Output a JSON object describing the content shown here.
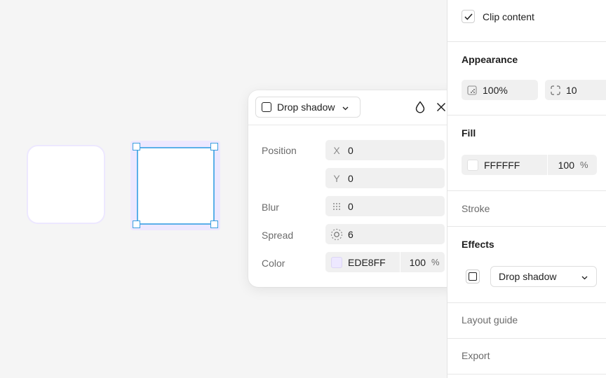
{
  "canvas": {
    "shadow_color": "#EDE8FF",
    "selection_color": "#3B9FE0"
  },
  "popover": {
    "effect_type": "Drop shadow",
    "icons": {
      "effect_swatch": "drop-shadow-icon",
      "chevron": "chevron-down-icon",
      "blend": "droplet-icon",
      "close": "close-icon"
    },
    "position_label": "Position",
    "x_prefix": "X",
    "x_value": "0",
    "y_prefix": "Y",
    "y_value": "0",
    "blur_label": "Blur",
    "blur_value": "0",
    "spread_label": "Spread",
    "spread_value": "6",
    "color_label": "Color",
    "color_hex": "EDE8FF",
    "color_opacity": "100",
    "percent": "%"
  },
  "panel": {
    "clip_content_label": "Clip content",
    "clip_content_checked": true,
    "appearance": {
      "title": "Appearance",
      "opacity": "100%",
      "corner_radius": "10"
    },
    "fill": {
      "title": "Fill",
      "hex": "FFFFFF",
      "opacity": "100",
      "percent": "%"
    },
    "stroke_title": "Stroke",
    "effects": {
      "title": "Effects",
      "type": "Drop shadow"
    },
    "layout_guide_title": "Layout guide",
    "export_title": "Export"
  }
}
